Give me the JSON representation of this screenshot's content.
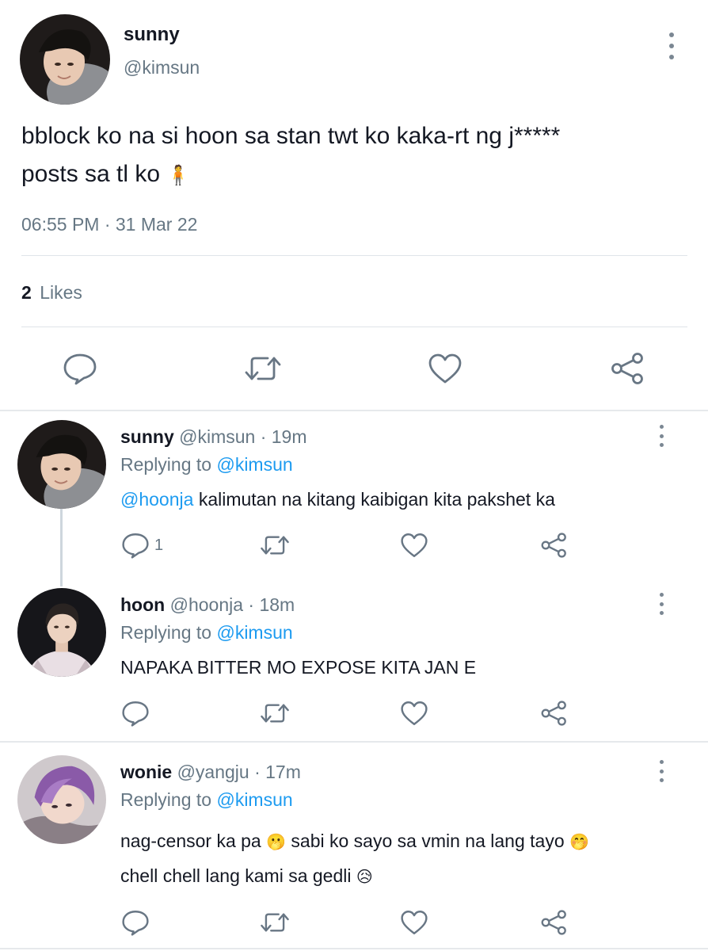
{
  "main_post": {
    "display_name": "sunny",
    "handle": "@kimsun",
    "text_line1": "bblock ko na si hoon sa stan twt ko kaka-rt ng j*****",
    "text_line2": "posts sa tl ko",
    "emoji": "🧍",
    "timestamp": "06:55 PM · 31 Mar 22",
    "likes_count": "2",
    "likes_label": "Likes"
  },
  "replies": [
    {
      "display_name": "sunny",
      "meta": "@kimsun · 19m",
      "replying_label": "Replying to",
      "replying_handle": "@kimsun",
      "mention": "@hoonja",
      "text": "kalimutan na kitang kaibigan kita pakshet ka",
      "reply_count": "1"
    },
    {
      "display_name": "hoon",
      "meta": "@hoonja · 18m",
      "replying_label": "Replying to",
      "replying_handle": "@kimsun",
      "text": "NAPAKA BITTER MO EXPOSE KITA JAN E"
    },
    {
      "display_name": "wonie",
      "meta": "@yangju · 17m",
      "replying_label": "Replying to",
      "replying_handle": "@kimsun",
      "text_line1": "nag-censor ka pa",
      "emoji1": "🫢",
      "text_line1b": "sabi ko sayo sa vmin na lang tayo",
      "emoji2": "🤭",
      "text_line2": "chell chell lang kami sa gedli",
      "emoji3": "😥"
    }
  ],
  "icons": {
    "reply": "reply-icon",
    "retweet": "retweet-icon",
    "like": "heart-icon",
    "share": "share-icon",
    "more": "more-icon"
  },
  "colors": {
    "link": "#1d9bf0",
    "muted": "#667784",
    "icon": "#687684"
  }
}
